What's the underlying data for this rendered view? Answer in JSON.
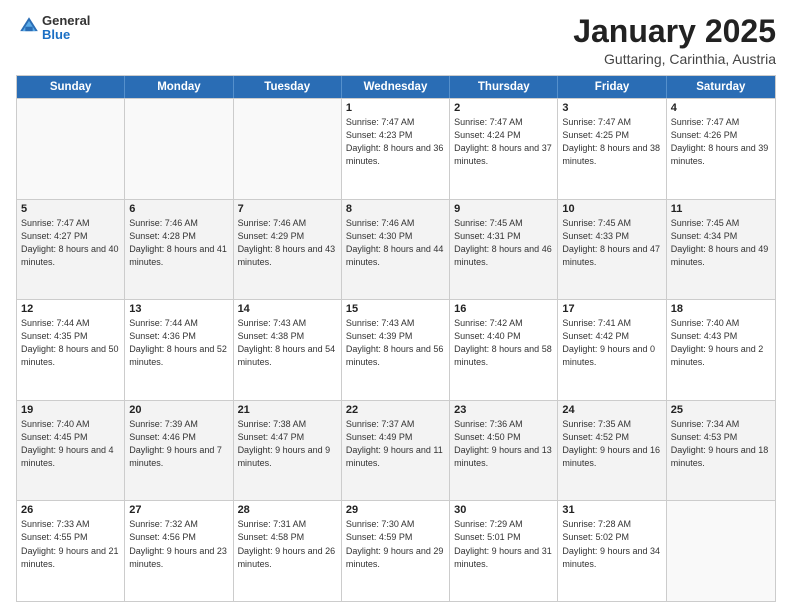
{
  "header": {
    "logo_general": "General",
    "logo_blue": "Blue",
    "title": "January 2025",
    "subtitle": "Guttaring, Carinthia, Austria"
  },
  "days_of_week": [
    "Sunday",
    "Monday",
    "Tuesday",
    "Wednesday",
    "Thursday",
    "Friday",
    "Saturday"
  ],
  "weeks": [
    [
      {
        "day": "",
        "info": ""
      },
      {
        "day": "",
        "info": ""
      },
      {
        "day": "",
        "info": ""
      },
      {
        "day": "1",
        "info": "Sunrise: 7:47 AM\nSunset: 4:23 PM\nDaylight: 8 hours and 36 minutes."
      },
      {
        "day": "2",
        "info": "Sunrise: 7:47 AM\nSunset: 4:24 PM\nDaylight: 8 hours and 37 minutes."
      },
      {
        "day": "3",
        "info": "Sunrise: 7:47 AM\nSunset: 4:25 PM\nDaylight: 8 hours and 38 minutes."
      },
      {
        "day": "4",
        "info": "Sunrise: 7:47 AM\nSunset: 4:26 PM\nDaylight: 8 hours and 39 minutes."
      }
    ],
    [
      {
        "day": "5",
        "info": "Sunrise: 7:47 AM\nSunset: 4:27 PM\nDaylight: 8 hours and 40 minutes."
      },
      {
        "day": "6",
        "info": "Sunrise: 7:46 AM\nSunset: 4:28 PM\nDaylight: 8 hours and 41 minutes."
      },
      {
        "day": "7",
        "info": "Sunrise: 7:46 AM\nSunset: 4:29 PM\nDaylight: 8 hours and 43 minutes."
      },
      {
        "day": "8",
        "info": "Sunrise: 7:46 AM\nSunset: 4:30 PM\nDaylight: 8 hours and 44 minutes."
      },
      {
        "day": "9",
        "info": "Sunrise: 7:45 AM\nSunset: 4:31 PM\nDaylight: 8 hours and 46 minutes."
      },
      {
        "day": "10",
        "info": "Sunrise: 7:45 AM\nSunset: 4:33 PM\nDaylight: 8 hours and 47 minutes."
      },
      {
        "day": "11",
        "info": "Sunrise: 7:45 AM\nSunset: 4:34 PM\nDaylight: 8 hours and 49 minutes."
      }
    ],
    [
      {
        "day": "12",
        "info": "Sunrise: 7:44 AM\nSunset: 4:35 PM\nDaylight: 8 hours and 50 minutes."
      },
      {
        "day": "13",
        "info": "Sunrise: 7:44 AM\nSunset: 4:36 PM\nDaylight: 8 hours and 52 minutes."
      },
      {
        "day": "14",
        "info": "Sunrise: 7:43 AM\nSunset: 4:38 PM\nDaylight: 8 hours and 54 minutes."
      },
      {
        "day": "15",
        "info": "Sunrise: 7:43 AM\nSunset: 4:39 PM\nDaylight: 8 hours and 56 minutes."
      },
      {
        "day": "16",
        "info": "Sunrise: 7:42 AM\nSunset: 4:40 PM\nDaylight: 8 hours and 58 minutes."
      },
      {
        "day": "17",
        "info": "Sunrise: 7:41 AM\nSunset: 4:42 PM\nDaylight: 9 hours and 0 minutes."
      },
      {
        "day": "18",
        "info": "Sunrise: 7:40 AM\nSunset: 4:43 PM\nDaylight: 9 hours and 2 minutes."
      }
    ],
    [
      {
        "day": "19",
        "info": "Sunrise: 7:40 AM\nSunset: 4:45 PM\nDaylight: 9 hours and 4 minutes."
      },
      {
        "day": "20",
        "info": "Sunrise: 7:39 AM\nSunset: 4:46 PM\nDaylight: 9 hours and 7 minutes."
      },
      {
        "day": "21",
        "info": "Sunrise: 7:38 AM\nSunset: 4:47 PM\nDaylight: 9 hours and 9 minutes."
      },
      {
        "day": "22",
        "info": "Sunrise: 7:37 AM\nSunset: 4:49 PM\nDaylight: 9 hours and 11 minutes."
      },
      {
        "day": "23",
        "info": "Sunrise: 7:36 AM\nSunset: 4:50 PM\nDaylight: 9 hours and 13 minutes."
      },
      {
        "day": "24",
        "info": "Sunrise: 7:35 AM\nSunset: 4:52 PM\nDaylight: 9 hours and 16 minutes."
      },
      {
        "day": "25",
        "info": "Sunrise: 7:34 AM\nSunset: 4:53 PM\nDaylight: 9 hours and 18 minutes."
      }
    ],
    [
      {
        "day": "26",
        "info": "Sunrise: 7:33 AM\nSunset: 4:55 PM\nDaylight: 9 hours and 21 minutes."
      },
      {
        "day": "27",
        "info": "Sunrise: 7:32 AM\nSunset: 4:56 PM\nDaylight: 9 hours and 23 minutes."
      },
      {
        "day": "28",
        "info": "Sunrise: 7:31 AM\nSunset: 4:58 PM\nDaylight: 9 hours and 26 minutes."
      },
      {
        "day": "29",
        "info": "Sunrise: 7:30 AM\nSunset: 4:59 PM\nDaylight: 9 hours and 29 minutes."
      },
      {
        "day": "30",
        "info": "Sunrise: 7:29 AM\nSunset: 5:01 PM\nDaylight: 9 hours and 31 minutes."
      },
      {
        "day": "31",
        "info": "Sunrise: 7:28 AM\nSunset: 5:02 PM\nDaylight: 9 hours and 34 minutes."
      },
      {
        "day": "",
        "info": ""
      }
    ]
  ]
}
